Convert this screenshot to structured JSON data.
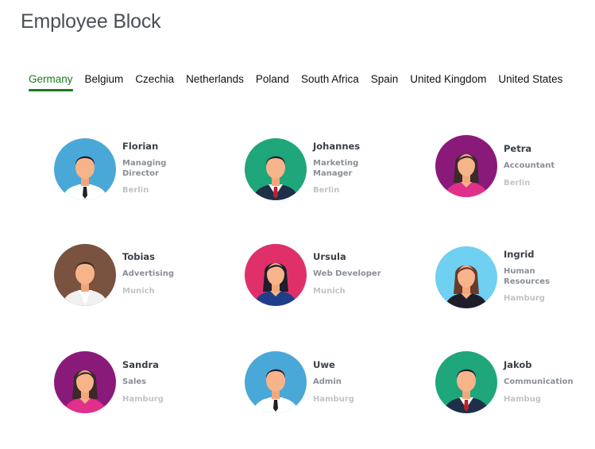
{
  "page": {
    "title": "Employee Block"
  },
  "tabs": [
    {
      "label": "Germany",
      "active": true
    },
    {
      "label": "Belgium",
      "active": false
    },
    {
      "label": "Czechia",
      "active": false
    },
    {
      "label": "Netherlands",
      "active": false
    },
    {
      "label": "Poland",
      "active": false
    },
    {
      "label": "South Africa",
      "active": false
    },
    {
      "label": "Spain",
      "active": false
    },
    {
      "label": "United Kingdom",
      "active": false
    },
    {
      "label": "United States",
      "active": false
    }
  ],
  "colors": {
    "active_tab": "#1c7a1c",
    "title": "#4a4f57"
  },
  "employees": [
    {
      "name": "Florian",
      "role": "Managing Director",
      "city": "Berlin",
      "avatar_bg": "#4aa8d8",
      "avatar_icon": "male-avatar-icon"
    },
    {
      "name": "Johannes",
      "role": "Marketing Manager",
      "city": "Berlin",
      "avatar_bg": "#1fa67a",
      "avatar_icon": "male-avatar-icon"
    },
    {
      "name": "Petra",
      "role": "Accountant",
      "city": "Berlin",
      "avatar_bg": "#8a1a7a",
      "avatar_icon": "female-avatar-icon"
    },
    {
      "name": "Tobias",
      "role": "Advertising",
      "city": "Munich",
      "avatar_bg": "#7a5240",
      "avatar_icon": "male-avatar-icon"
    },
    {
      "name": "Ursula",
      "role": "Web Developer",
      "city": "Munich",
      "avatar_bg": "#e0306a",
      "avatar_icon": "female-avatar-icon"
    },
    {
      "name": "Ingrid",
      "role": "Human Resources",
      "city": "Hamburg",
      "avatar_bg": "#6fd0f2",
      "avatar_icon": "female-avatar-icon"
    },
    {
      "name": "Sandra",
      "role": "Sales",
      "city": "Hamburg",
      "avatar_bg": "#8a1a7a",
      "avatar_icon": "female-avatar-icon"
    },
    {
      "name": "Uwe",
      "role": "Admin",
      "city": "Hamburg",
      "avatar_bg": "#4aa8d8",
      "avatar_icon": "male-avatar-icon"
    },
    {
      "name": "Jakob",
      "role": "Communication",
      "city": "Hambug",
      "avatar_bg": "#1fa67a",
      "avatar_icon": "male-avatar-icon"
    }
  ]
}
